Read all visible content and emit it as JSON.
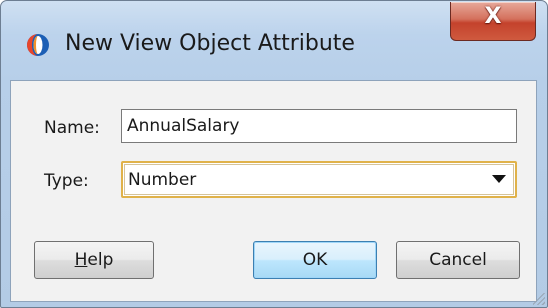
{
  "window": {
    "title": "New View Object Attribute",
    "app_icon": "oracle-jdeveloper-icon",
    "close_label": "X"
  },
  "form": {
    "name_label": "Name:",
    "name_value": "AnnualSalary",
    "type_label": "Type:",
    "type_value": "Number"
  },
  "buttons": {
    "help_first": "H",
    "help_rest": "elp",
    "ok_label": "OK",
    "cancel_label": "Cancel"
  },
  "colors": {
    "title_bar": "#bcd3ec",
    "client_bg": "#f2f2f2",
    "close_button": "#c4422c",
    "focus_ring": "#e0b24a",
    "default_button": "#bde6fd"
  }
}
